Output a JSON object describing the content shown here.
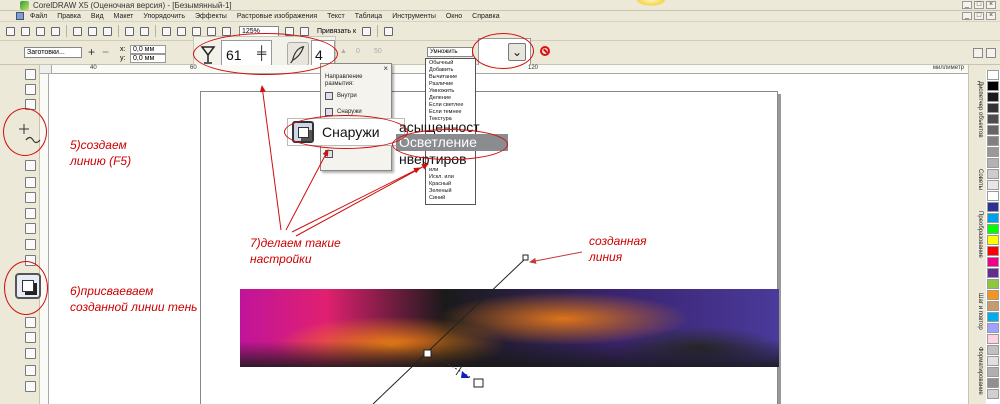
{
  "window": {
    "title": "CorelDRAW X5 (Оценочная версия) - [Безымянный-1]",
    "controls": [
      "_",
      "□",
      "×"
    ]
  },
  "menu": [
    "Файл",
    "Правка",
    "Вид",
    "Макет",
    "Упорядочить",
    "Эффекты",
    "Растровые изображения",
    "Текст",
    "Таблица",
    "Инструменты",
    "Окно",
    "Справка"
  ],
  "toolbar": {
    "zoom": "125%",
    "snap_label": "Привязать к"
  },
  "property_bar": {
    "preset": "Заготовки...",
    "x_label": "x:",
    "x_value": "0,0 мм",
    "y_label": "y:",
    "y_value": "0,0 мм",
    "opacity": "61",
    "feather": "4",
    "faded_a": "0",
    "faded_b": "50",
    "blend_mode": "Умножить"
  },
  "ruler": {
    "ticks": [
      "40",
      "60",
      "80",
      "100",
      "120"
    ],
    "units": "миллиметр"
  },
  "flyout": {
    "title": "Направление размытия:",
    "items": [
      "Внутри",
      "Снаружи"
    ],
    "big_label": "Снаружи"
  },
  "blend_modes": [
    "Обычный",
    "Добавить",
    "Вычитание",
    "Различие",
    "Умножить",
    "Деление",
    "Если светлее",
    "Если темнее",
    "Текстура",
    "или",
    "Искл. или",
    "Красный",
    "Зеленый",
    "Синий"
  ],
  "blend_zoom": {
    "top": "асыщенност",
    "selected": "Осветление",
    "bottom": "нвертиров"
  },
  "docker_tabs": [
    "Диспетчер объектов",
    "Советы",
    "Преобразование",
    "Шаг и повтор",
    "Форматирование"
  ],
  "palette_colors": [
    "#ffffff",
    "#000000",
    "#1a1a1a",
    "#333333",
    "#4d4d4d",
    "#666666",
    "#808080",
    "#999999",
    "#b3b3b3",
    "#cccccc",
    "#e6e6e6",
    "#ffffff",
    "#2e3192",
    "#00a0e9",
    "#00ff00",
    "#ffff00",
    "#ff0000",
    "#ec008c",
    "#662d91",
    "#8dc63f",
    "#f7941d",
    "#c69c6d",
    "#00aeef",
    "#a0a0ff",
    "#ffd0e0",
    "#c0c0c0",
    "#e0e0e0",
    "#b0b0b0",
    "#909090",
    "#d0d0d0"
  ],
  "annotations": {
    "a5_line1": "5)создаем",
    "a5_line2": "линию (F5)",
    "a6_line1": "6)присваеваем",
    "a6_line2": "созданной линии тень",
    "a7_line1": "7)делаем такие",
    "a7_line2": "настройки",
    "line_label1": "созданная",
    "line_label2": "линия"
  },
  "accent_color": "#cc0000"
}
